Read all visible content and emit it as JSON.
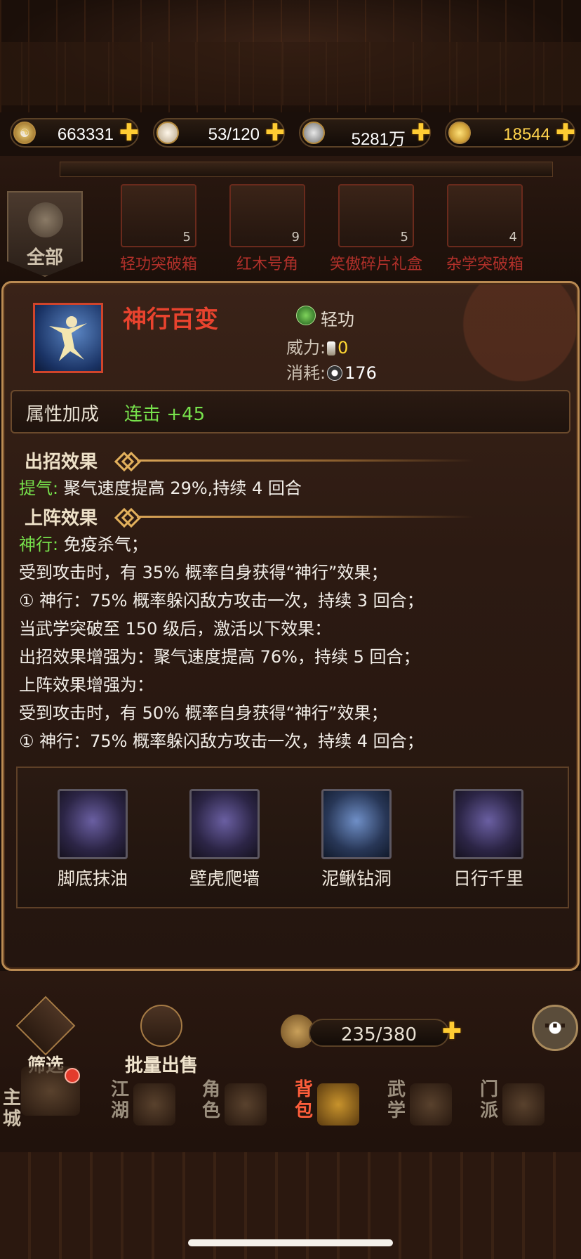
{
  "resources": [
    {
      "icon": "taiji-coin-icon",
      "value": "663331"
    },
    {
      "icon": "steamed-bun-icon",
      "value": "53/120"
    },
    {
      "icon": "silver-coin-icon",
      "value": "5281万"
    },
    {
      "icon": "gold-ingot-icon",
      "value": "18544"
    }
  ],
  "filter_tab": {
    "label": "全部"
  },
  "shelf_items": [
    {
      "name": "轻功突破箱",
      "count": "5"
    },
    {
      "name": "红木号角",
      "count": "9"
    },
    {
      "name": "笑傲碎片礼盒",
      "count": "5"
    },
    {
      "name": "杂学突破箱",
      "count": "4"
    }
  ],
  "skill": {
    "name": "神行百变",
    "type": "轻功",
    "power_label": "威力:",
    "power_value": "0",
    "cost_label": "消耗:",
    "cost_value": "176",
    "attr_label": "属性加成",
    "attr_value": "连击 +45",
    "attack_effect_heading": "出招效果",
    "attack_effect": {
      "key": "提气:",
      "text": " 聚气速度提高 29%,持续 4 回合"
    },
    "formation_effect_heading": "上阵效果",
    "formation_effect_key": "神行:",
    "formation_effect_first": " 免疫杀气；",
    "formation_lines": [
      "受到攻击时，有 35% 概率自身获得“神行”效果；",
      "① 神行：75% 概率躲闪敌方攻击一次，持续 3 回合；",
      "当武学突破至 150 级后，激活以下效果：",
      "出招效果增强为：聚气速度提高 76%，持续 5 回合；",
      "上阵效果增强为：",
      "受到攻击时，有 50% 概率自身获得“神行”效果；",
      "① 神行：75% 概率躲闪敌方攻击一次，持续 4 回合；"
    ],
    "sub_skills": [
      {
        "name": "脚底抹油"
      },
      {
        "name": "壁虎爬墙"
      },
      {
        "name": "泥鳅钻洞"
      },
      {
        "name": "日行千里"
      }
    ]
  },
  "toolbar": {
    "filter_label": "筛选",
    "bulk_sell_label": "批量出售",
    "capacity": "235/380"
  },
  "nav": [
    {
      "label": "主城"
    },
    {
      "label": "江湖"
    },
    {
      "label": "角色"
    },
    {
      "label": "背包"
    },
    {
      "label": "武学"
    },
    {
      "label": "门派"
    }
  ],
  "colors": {
    "skill_name": "#e8432e",
    "effect_key_green": "#77e24c",
    "power_value_yellow": "#ffd733",
    "gold_value": "#ffd34d",
    "active_nav": "#ff5e3b"
  }
}
